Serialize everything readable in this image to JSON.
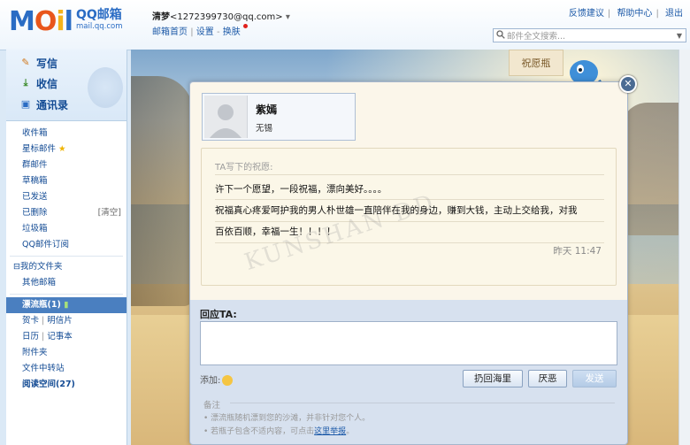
{
  "header": {
    "logo_mo": "MOil",
    "logo_cn": "QQ邮箱",
    "logo_url": "mail.qq.com",
    "nickname": "清梦",
    "email": "<1272399730@qq.com>",
    "dropdown": "▾",
    "home_link": "邮箱首页",
    "settings_link": "设置",
    "switch_link": "换肤",
    "feedback": "反馈建议",
    "help": "帮助中心",
    "logout": "退出",
    "search_placeholder": "邮件全文搜索..."
  },
  "sidebar": {
    "compose": "写信",
    "receive": "收信",
    "contacts": "通讯录",
    "folders": [
      {
        "label": "收件箱"
      },
      {
        "label": "星标邮件"
      },
      {
        "label": "群邮件"
      },
      {
        "label": "草稿箱"
      },
      {
        "label": "已发送"
      },
      {
        "label": "已删除",
        "aux": "[清空]"
      },
      {
        "label": "垃圾箱"
      },
      {
        "label": "QQ邮件订阅"
      }
    ],
    "my_folders": "⊟我的文件夹",
    "other_mailbox": "其他邮箱",
    "drift_bottle": "漂流瓶(1)",
    "greeting_card": "贺卡",
    "postcard": "明信片",
    "calendar": "日历",
    "notepad": "记事本",
    "attachments": "附件夹",
    "file_transfer": "文件中转站",
    "reading": "阅读空间(27)"
  },
  "main": {
    "bottle_tag": "祝愿瓶"
  },
  "dialog": {
    "close": "✕",
    "name": "紫嫣",
    "city": "无锡",
    "wish_header": "TA写下的祝愿:",
    "line1": "许下一个愿望，一段祝福，漂向美好。。。。",
    "line2": "祝福真心疼爱呵护我的男人朴世雄一直陪伴在我的身边，赚到大钱，主动上交给我，对我",
    "line3": "百依百顺，幸福一生！！！！",
    "time": "昨天 11:47",
    "watermark": "KUNSHAN DD",
    "reply_label": "回应TA:",
    "add_label": "添加:",
    "btn_throw": "扔回海里",
    "btn_hate": "厌恶",
    "btn_send": "发送",
    "note_title": "备注",
    "note1": "• 漂流瓶随机漂到您的沙滩，并非针对您个人。",
    "note2_pre": "• 若瓶子包含不适内容，可点击",
    "note2_link": "这里举报",
    "note2_post": "。"
  },
  "colors": {
    "brand_blue": "#2a6cc4",
    "active_folder": "#4a7fc0",
    "link": "#1d5aa8"
  }
}
